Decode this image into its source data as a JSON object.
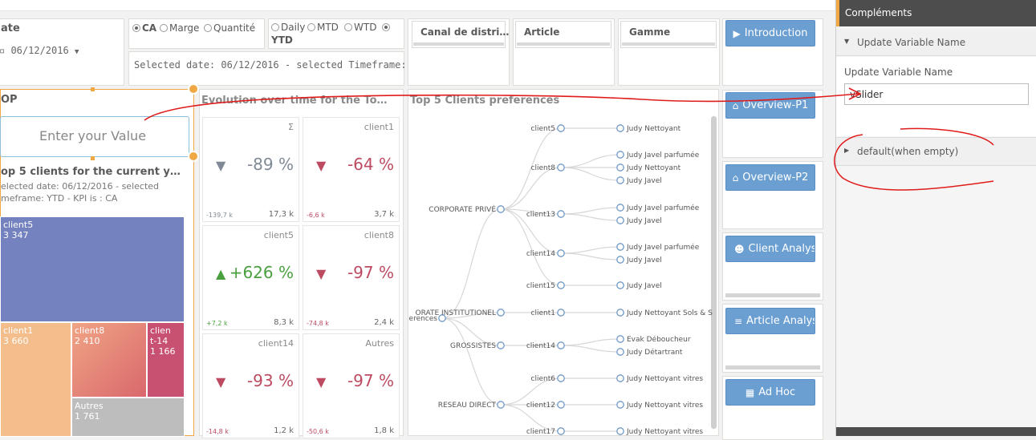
{
  "date": {
    "title": "ate",
    "value": "06/12/2016"
  },
  "measure_radios": [
    {
      "label": "CA",
      "selected": true
    },
    {
      "label": "Marge",
      "selected": false
    },
    {
      "label": "Quantité",
      "selected": false
    }
  ],
  "timeframe_radios": [
    {
      "label": "Daily",
      "selected": false
    },
    {
      "label": "MTD",
      "selected": false
    },
    {
      "label": "WTD",
      "selected": false
    },
    {
      "label": "YTD",
      "selected": true
    }
  ],
  "selected_text": "Selected date: 06/12/2016 - selected Timeframe: YTD",
  "filters": [
    "Canal de distri…",
    "Article",
    "Gamme"
  ],
  "nav_buttons": [
    "Introduction",
    "Overview-P1",
    "Overview-P2",
    "Client Analysis",
    "Article Analysis",
    "Ad Hoc"
  ],
  "top_panel": {
    "title": "OP",
    "input_placeholder": "Enter your Value",
    "subtitle": "op 5 clients for the current y…",
    "desc1": "elected date: 06/12/2016 - selected",
    "desc2": "meframe: YTD - KPI is : CA"
  },
  "treemap": [
    {
      "name": "client5",
      "value": "3 347",
      "color": "#7483c0"
    },
    {
      "name": "client1",
      "value": "3 660",
      "color": "#f4bd8c"
    },
    {
      "name": "client8",
      "value": "2 410",
      "color": "#e3806a"
    },
    {
      "name": "client-14",
      "value": "1 166",
      "color": "#c85070"
    },
    {
      "name": "Autres",
      "value": "1 761",
      "color": "#bdbdbd"
    }
  ],
  "evolution": {
    "title": "Evolution over time for the To…",
    "cards": [
      {
        "name": "Σ",
        "value": "-89 %",
        "low": "-139,7 k",
        "high": "17,3 k",
        "trend": "down",
        "color": "#808a96"
      },
      {
        "name": "client1",
        "value": "-64 %",
        "low": "-6,6 k",
        "high": "3,7 k",
        "trend": "down",
        "color": "#bc4b62"
      },
      {
        "name": "client5",
        "value": "+626 %",
        "low": "+7,2 k",
        "high": "8,3 k",
        "trend": "up",
        "color": "#4aa03f"
      },
      {
        "name": "client8",
        "value": "-97 %",
        "low": "-74,8 k",
        "high": "2,4 k",
        "trend": "down",
        "color": "#bc4b62"
      },
      {
        "name": "client14",
        "value": "-93 %",
        "low": "-14,8 k",
        "high": "1,2 k",
        "trend": "down",
        "color": "#bc4b62"
      },
      {
        "name": "Autres",
        "value": "-97 %",
        "low": "-50,6 k",
        "high": "1,8 k",
        "trend": "down",
        "color": "#bc4b62"
      }
    ]
  },
  "tree": {
    "title": "Top 5 Clients preferences",
    "root": "erences",
    "groups": [
      "CORPORATE PRIVÉ",
      "ORATE INSTITUTIONEL",
      "GROSSISTES",
      "RESEAU DIRECT"
    ],
    "clients": [
      "client5",
      "client8",
      "client13",
      "client14",
      "client15",
      "client1",
      "client14",
      "client6",
      "client12",
      "client17"
    ],
    "articles": [
      "Judy Nettoyant",
      "Judy Javel parfumée",
      "Judy Nettoyant",
      "Judy Javel",
      "Judy Javel parfumée",
      "Judy Javel",
      "Judy Javel parfumée",
      "Judy Javel",
      "Judy Javel",
      "Judy Nettoyant Sols & S",
      "Evak Déboucheur",
      "Judy Détartrant",
      "Judy Nettoyant vitres",
      "Judy Nettoyant vitres",
      "Judy Nettoyant vitres"
    ]
  },
  "right_panel": {
    "header": "Compléments",
    "section": "Update Variable Name",
    "field_label": "Update Variable Name",
    "field_value": "vSlider",
    "default_label": "default(when empty)"
  }
}
